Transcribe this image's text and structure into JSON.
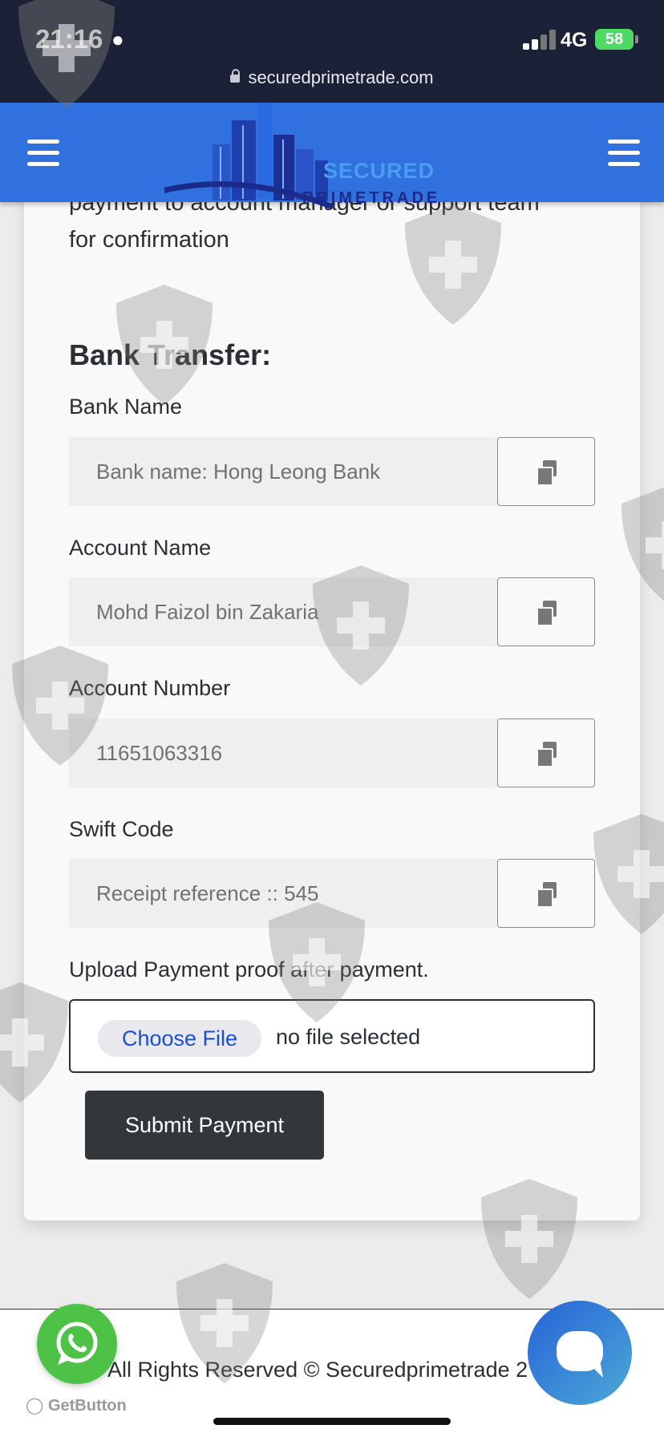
{
  "status_bar": {
    "time": "21:16",
    "time_icon": "flame-icon",
    "network": "4G",
    "battery": "58",
    "url": "securedprimetrade.com"
  },
  "header": {
    "logo_line1": "SECURED",
    "logo_line2": "PRIMETRADE",
    "menu_left_icon": "hamburger-icon",
    "menu_right_icon": "hamburger-icon"
  },
  "main": {
    "intro_text": "payment to account manager or support team for confirmation",
    "section_title": "Bank Transfer:",
    "fields": [
      {
        "label": "Bank Name",
        "value": "Bank name: Hong Leong Bank"
      },
      {
        "label": "Account Name",
        "value": "Mohd Faizol bin Zakaria"
      },
      {
        "label": "Account Number",
        "value": "11651063316"
      },
      {
        "label": "Swift Code",
        "value": "Receipt reference :: 545"
      }
    ],
    "upload_label": "Upload Payment proof after payment.",
    "choose_file_label": "Choose File",
    "file_status": "no file selected",
    "submit_label": "Submit Payment"
  },
  "footer": {
    "copyright": "All Rights Reserved © Securedprimetrade 2",
    "getbutton_label": "GetButton"
  },
  "colors": {
    "header_bg": "#3170df",
    "status_bar_bg": "#1b2136",
    "submit_bg": "#33373b",
    "whatsapp_green": "#4dc247",
    "battery_green": "#4cd964"
  }
}
